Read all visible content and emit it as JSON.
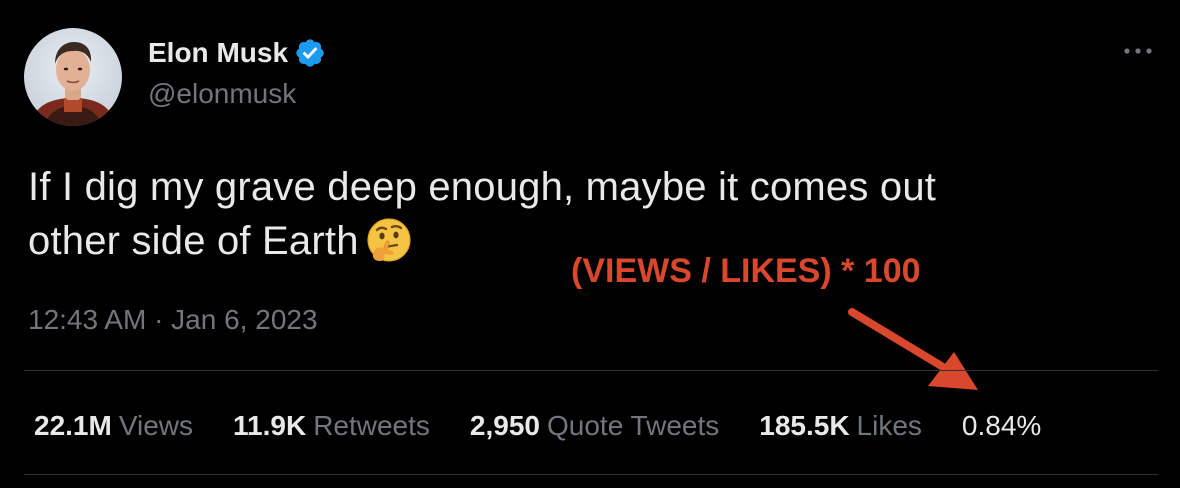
{
  "author": {
    "name": "Elon Musk",
    "handle": "@elonmusk",
    "verified": true,
    "verified_color": "#1d9bf0"
  },
  "tweet": {
    "text_line1": "If I dig my grave deep enough, maybe it comes out",
    "text_line2": "other side of Earth",
    "emoji": "thinking-face",
    "timestamp": "12:43 AM · Jan 6, 2023"
  },
  "stats": [
    {
      "value": "22.1M",
      "label": "Views"
    },
    {
      "value": "11.9K",
      "label": "Retweets"
    },
    {
      "value": "2,950",
      "label": "Quote Tweets"
    },
    {
      "value": "185.5K",
      "label": "Likes"
    }
  ],
  "annotation": {
    "formula": "(VIEWS / LIKES) * 100",
    "result": "0.84%",
    "color": "#d9472d"
  },
  "icons": {
    "more": "more-horizontal-icon",
    "verified": "verified-badge-icon",
    "arrow": "arrow-down-right-icon"
  },
  "colors": {
    "background": "#000000",
    "primary_text": "#e7e9ea",
    "secondary_text": "#71767b",
    "divider": "#2f3336"
  }
}
